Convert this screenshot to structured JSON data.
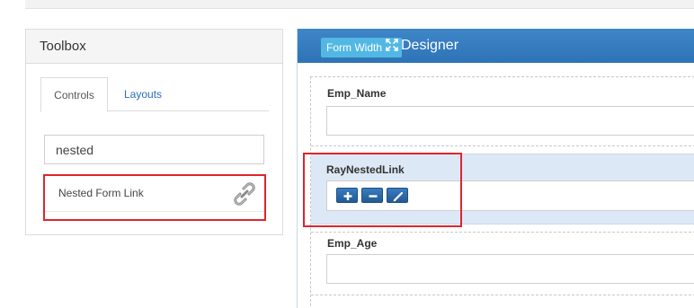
{
  "toolbox": {
    "title": "Toolbox",
    "tabs": [
      {
        "label": "Controls",
        "active": true
      },
      {
        "label": "Layouts",
        "active": false
      }
    ],
    "search": {
      "value": "nested",
      "placeholder": ""
    },
    "results": [
      {
        "label": "Nested Form Link",
        "icon": "chain-link-icon"
      }
    ]
  },
  "designer": {
    "title": "Designer",
    "form_width_label": "Form Width",
    "form_width_icon": "expand-arrows-icon",
    "fields": [
      {
        "label": "Emp_Name",
        "type": "text"
      },
      {
        "label": "RayNestedLink",
        "type": "nested-link",
        "actions": [
          "add-icon",
          "remove-icon",
          "edit-icon"
        ]
      },
      {
        "label": "Emp_Age",
        "type": "text"
      }
    ]
  },
  "colors": {
    "header_blue": "#2f76b9",
    "highlight_red": "#e0242e",
    "selected_row": "#dce8f5",
    "form_width_button": "#52b8e3"
  }
}
